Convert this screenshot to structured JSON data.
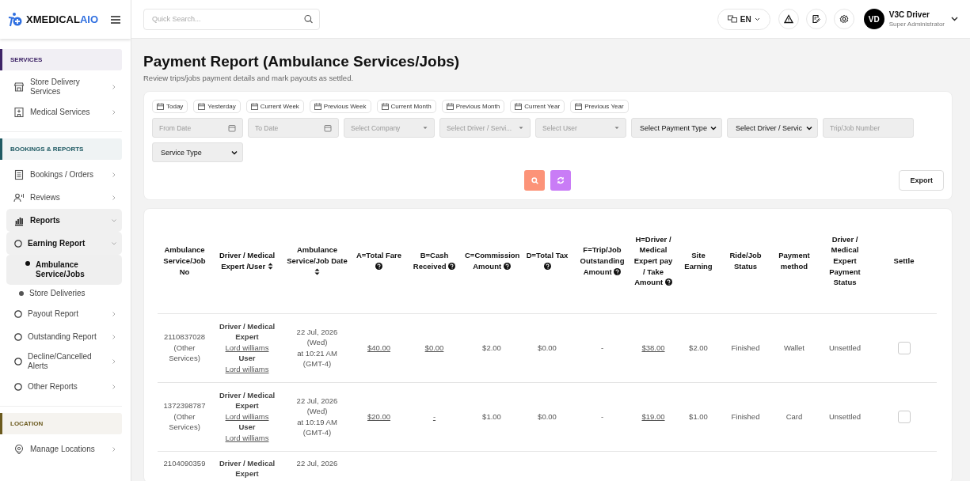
{
  "brand": {
    "name_dark": "XMEDICAL",
    "name_accent": "AIO"
  },
  "header": {
    "search": {
      "placeholder": "Quick Search..."
    },
    "language": "EN",
    "user": {
      "initials": "VD",
      "name": "V3C Driver",
      "role": "Super Administrator"
    }
  },
  "sidebar": {
    "sections": [
      {
        "title": "SERVICES",
        "color": "#3d2366",
        "items": [
          {
            "label": "Store Delivery Services",
            "expanded": false,
            "selected": false
          },
          {
            "label": "Medical Services",
            "expanded": false,
            "selected": false
          }
        ]
      },
      {
        "title": "BOOKINGS & REPORTS",
        "color": "#1f5a63",
        "items": [
          {
            "label": "Bookings / Orders",
            "expanded": false,
            "selected": false
          },
          {
            "label": "Reviews",
            "expanded": false,
            "selected": false
          },
          {
            "label": "Reports",
            "expanded": true,
            "selected": false,
            "children": [
              {
                "label": "Earning Report",
                "expanded": true,
                "selected": false,
                "children": [
                  {
                    "label": "Ambulance Service/Jobs",
                    "selected": true
                  },
                  {
                    "label": "Store Deliveries",
                    "selected": false
                  }
                ]
              },
              {
                "label": "Payout Report",
                "expanded": false,
                "selected": false
              },
              {
                "label": "Outstanding Report",
                "expanded": false,
                "selected": false
              },
              {
                "label": "Decline/Cancelled Alerts",
                "expanded": false,
                "selected": false
              },
              {
                "label": "Other Reports",
                "expanded": false,
                "selected": false
              }
            ]
          }
        ]
      },
      {
        "title": "LOCATION",
        "color": "#6b5a1e",
        "items": [
          {
            "label": "Manage Locations",
            "expanded": false,
            "selected": false
          }
        ]
      }
    ]
  },
  "page": {
    "title": "Payment Report (Ambulance Services/Jobs)",
    "subtitle": "Review trips/jobs payment details and mark payouts as settled."
  },
  "filters": {
    "ranges": [
      "Today",
      "Yesterday",
      "Current Week",
      "Previous Week",
      "Current Month",
      "Previous Month",
      "Current Year",
      "Previous Year"
    ],
    "fields": [
      {
        "kind": "date",
        "placeholder": "From Date"
      },
      {
        "kind": "date",
        "placeholder": "To Date"
      },
      {
        "kind": "select",
        "placeholder": "Select Company"
      },
      {
        "kind": "select",
        "placeholder": "Select Driver / Servi..."
      },
      {
        "kind": "select",
        "placeholder": "Select User"
      },
      {
        "kind": "dropdown",
        "value": "Select Payment Type"
      },
      {
        "kind": "dropdown",
        "value": "Select Driver / Servic"
      },
      {
        "kind": "text",
        "placeholder": "Trip/Job Number"
      },
      {
        "kind": "dropdown",
        "value": "Service Type"
      }
    ],
    "export_label": "Export"
  },
  "table": {
    "columns": [
      {
        "label": "Ambulance Service/Job No",
        "sortable": false,
        "help": false
      },
      {
        "label": "Driver / Medical Expert /User",
        "sortable": true,
        "help": false
      },
      {
        "label": "Ambulance Service/Job Date",
        "sortable": true,
        "help": false
      },
      {
        "label": "A=Total Fare",
        "sortable": false,
        "help": true
      },
      {
        "label": "B=Cash Received",
        "sortable": false,
        "help": true
      },
      {
        "label": "C=Commission Amount",
        "sortable": false,
        "help": true
      },
      {
        "label": "D=Total Tax",
        "sortable": false,
        "help": true
      },
      {
        "label": "F=Trip/Job Outstanding Amount",
        "sortable": false,
        "help": true
      },
      {
        "label": "H=Driver / Medical Expert pay / Take Amount",
        "sortable": false,
        "help": true
      },
      {
        "label": "Site Earning",
        "sortable": false,
        "help": false
      },
      {
        "label": "Ride/Job Status",
        "sortable": false,
        "help": false
      },
      {
        "label": "Payment method",
        "sortable": false,
        "help": false
      },
      {
        "label": "Driver / Medical Expert Payment Status",
        "sortable": false,
        "help": false
      },
      {
        "label": "Settle",
        "sortable": false,
        "help": false
      }
    ],
    "rows": [
      {
        "job_no": "2110837028",
        "job_type": "(Other Services)",
        "expert_label": "Driver / Medical Expert",
        "expert_name": "Lord williams",
        "user_label": "User",
        "user_name": "Lord williams",
        "date": [
          "22 Jul, 2026",
          "(Wed)",
          "at 10:21 AM",
          "(GMT-4)"
        ],
        "total_fare": "$40.00",
        "cash_received": "$0.00",
        "commission": "$2.00",
        "tax": "$0.00",
        "outstanding": "-",
        "driver_pay": "$38.00",
        "site_earning": "$2.00",
        "status": "Finished",
        "payment_method": "Wallet",
        "payout_status": "Unsettled",
        "settled": false
      },
      {
        "job_no": "1372398787",
        "job_type": "(Other Services)",
        "expert_label": "Driver / Medical Expert",
        "expert_name": "Lord williams",
        "user_label": "User",
        "user_name": "Lord williams",
        "date": [
          "22 Jul, 2026",
          "(Wed)",
          "at 10:19 AM",
          "(GMT-4)"
        ],
        "total_fare": "$20.00",
        "cash_received": "-",
        "commission": "$1.00",
        "tax": "$0.00",
        "outstanding": "-",
        "driver_pay": "$19.00",
        "site_earning": "$1.00",
        "status": "Finished",
        "payment_method": "Card",
        "payout_status": "Unsettled",
        "settled": false
      },
      {
        "job_no": "2104090359",
        "expert_label": "Driver / Medical Expert",
        "date": [
          "22 Jul, 2026"
        ]
      }
    ]
  }
}
